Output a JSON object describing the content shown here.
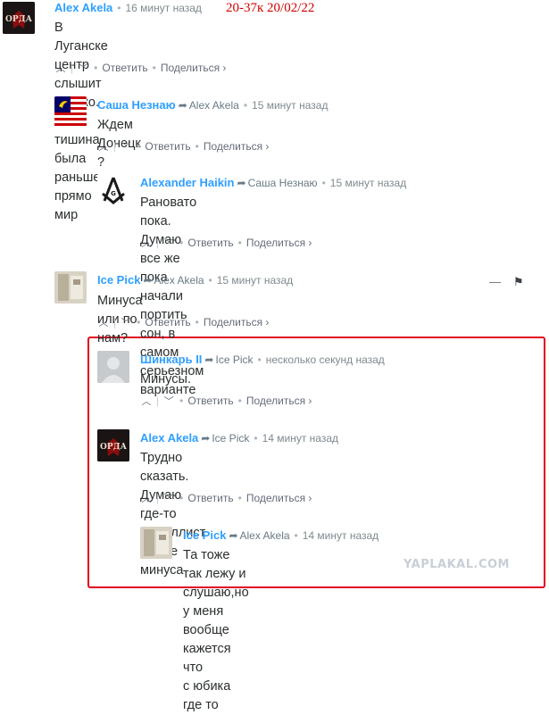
{
  "stamp": "20-37к 20/02/22",
  "watermark": "YAPLAKAL.COM",
  "labels": {
    "reply": "Ответить",
    "share": "Поделиться ›",
    "up": "^",
    "down": "v",
    "horde_logo": "ОРДА"
  },
  "icons": {
    "reply_arrow": "reply-arrow-icon",
    "collapse": "minimize-icon",
    "flag": "flag-icon"
  },
  "colors": {
    "author": "#2e9fff",
    "highlight_border": "#e2061c",
    "stamp": "#d40000"
  },
  "comments": [
    {
      "author": "Alex Akela",
      "reply_to": "",
      "time": "16 минут назад",
      "lines": [
        "В Луганске центр слышит громко.",
        "Хотя тишина была раньше прямо мир"
      ]
    },
    {
      "author": "Саша Незнаю",
      "reply_to": "Alex Akela",
      "time": "15 минут назад",
      "lines": [
        "Ждем Донецк ?"
      ]
    },
    {
      "author": "Alexander Haikin",
      "reply_to": "Саша Незнаю",
      "time": "15 минут назад",
      "lines": [
        "Рановато пока. Думаю все же пока начали портить сон, в самом",
        "серьезном варианте"
      ]
    },
    {
      "author": "Ice Pick",
      "reply_to": "Alex Akela",
      "time": "15 минут назад",
      "lines": [
        "Минуса или по нам?"
      ]
    },
    {
      "author": "Шинкарь II",
      "reply_to": "Ice Pick",
      "time": "несколько секунд назад",
      "lines": [
        "Минусы."
      ]
    },
    {
      "author": "Alex Akela",
      "reply_to": "Ice Pick",
      "time": "14 минут назад",
      "lines": [
        "Трудно сказать. Думаю где-то Металлист.",
        "Вроде минуса"
      ]
    },
    {
      "author": "Ice Pick",
      "reply_to": "Alex Akela",
      "time": "14 минут назад",
      "lines": [
        "Та тоже так лежу и слушаю,но у меня вообще кажется что",
        "с юбика где то"
      ]
    }
  ]
}
